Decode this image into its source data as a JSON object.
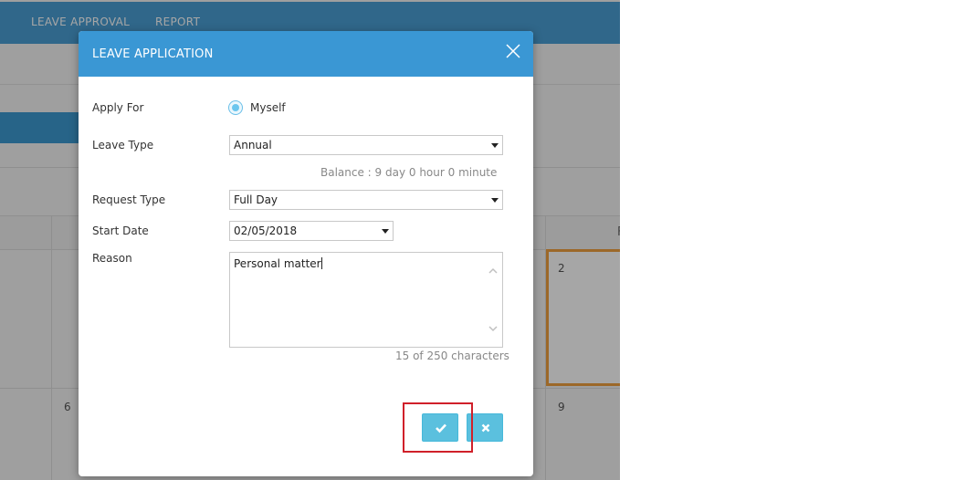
{
  "nav": {
    "items": [
      "LEAVE APPROVAL",
      "REPORT"
    ]
  },
  "calendar": {
    "day_numbers": [
      "2",
      "6",
      "9"
    ],
    "header_letter": "F"
  },
  "modal": {
    "title": "LEAVE APPLICATION",
    "apply_for": {
      "label": "Apply For",
      "selected_option": "Myself"
    },
    "leave_type": {
      "label": "Leave Type",
      "value": "Annual",
      "balance": "Balance : 9 day 0 hour 0 minute"
    },
    "request_type": {
      "label": "Request Type",
      "value": "Full Day"
    },
    "start_date": {
      "label": "Start Date",
      "value": "02/05/2018"
    },
    "reason": {
      "label": "Reason",
      "value": "Personal matter",
      "char_count": "15 of 250 characters"
    }
  },
  "colors": {
    "header": "#3a97d4",
    "button": "#5bc0de",
    "highlight": "#d0202a",
    "today_border": "#f0a040"
  },
  "icons": {
    "close": "close-icon",
    "confirm": "check-icon",
    "cancel": "x-icon"
  }
}
